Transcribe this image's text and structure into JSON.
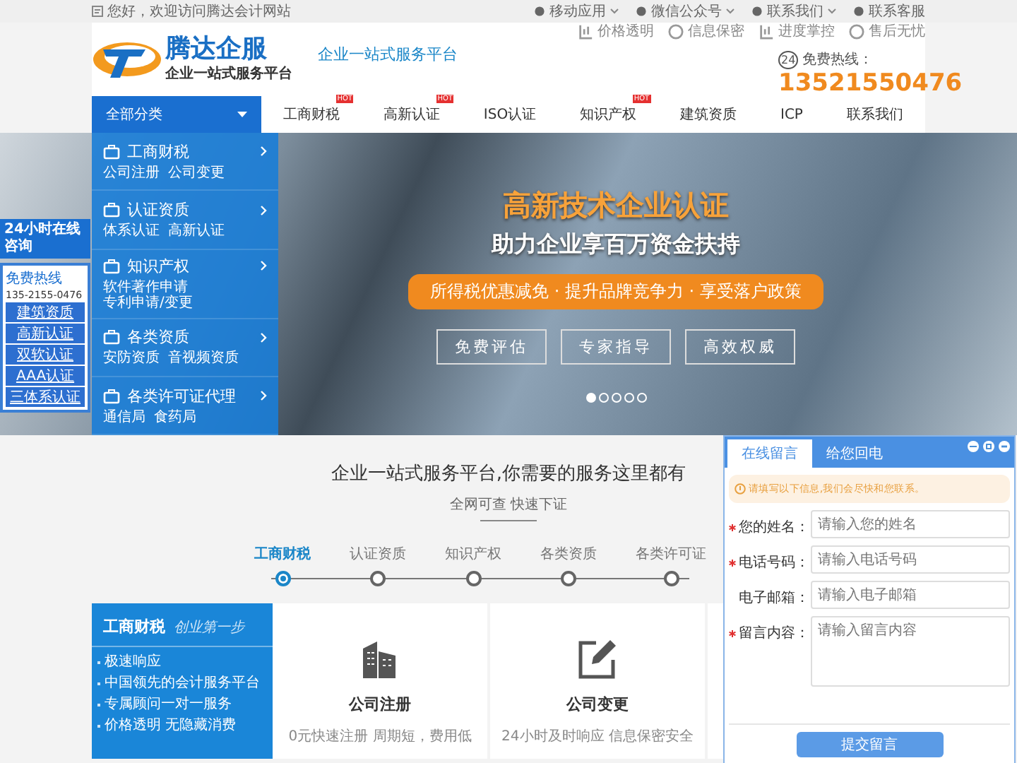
{
  "top_bar": {
    "greeting": "您好，欢迎访问腾达会计网站",
    "links": [
      {
        "label": "移动应用",
        "dropdown": true
      },
      {
        "label": "微信公众号",
        "dropdown": true
      },
      {
        "label": "联系我们",
        "dropdown": true
      },
      {
        "label": "联系客服",
        "dropdown": false
      }
    ]
  },
  "header": {
    "logo_name": "腾达企服",
    "logo_tagline": "企业一站式服务平台",
    "slogan": "企业一站式服务平台",
    "features": [
      {
        "label": "价格透明"
      },
      {
        "label": "信息保密"
      },
      {
        "label": "进度掌控"
      },
      {
        "label": "售后无忧"
      }
    ],
    "hotline": {
      "badge": "24",
      "label": "免费热线：",
      "number": "13521550476"
    }
  },
  "nav": {
    "category_label": "全部分类",
    "items": [
      {
        "label": "工商财税",
        "badge": "HOT"
      },
      {
        "label": "高新认证",
        "badge": "HOT"
      },
      {
        "label": "ISO认证"
      },
      {
        "label": "知识产权",
        "badge": "HOT"
      },
      {
        "label": "建筑资质"
      },
      {
        "label": "ICP"
      },
      {
        "label": "联系我们"
      }
    ]
  },
  "category_menu": [
    {
      "title": "工商财税",
      "links": [
        "公司注册",
        "公司变更"
      ]
    },
    {
      "title": "认证资质",
      "links": [
        "体系认证",
        "高新认证"
      ]
    },
    {
      "title": "知识产权",
      "links": [
        "软件著作申请",
        "专利申请/变更"
      ]
    },
    {
      "title": "各类资质",
      "links": [
        "安防资质",
        "音视频资质"
      ]
    },
    {
      "title": "各类许可证代理",
      "links": [
        "通信局",
        "食药局"
      ]
    }
  ],
  "hero": {
    "title": "高新技术企业认证",
    "subtitle": "助力企业享百万资金扶持",
    "banner": "所得税优惠减免 · 提升品牌竞争力 · 享受落户政策",
    "buttons": [
      "免费评估",
      "专家指导",
      "高效权威"
    ],
    "dots": [
      {
        "selected": true
      },
      {
        "selected": false
      },
      {
        "selected": false
      },
      {
        "selected": false
      },
      {
        "selected": false
      }
    ]
  },
  "consult_widget": {
    "header": "24小时在线咨询",
    "hotline_label": "免费热线",
    "phone": "135-2155-0476",
    "links": [
      "建筑资质",
      "高新认证",
      "双软认证",
      "AAA认证",
      "三体系认证"
    ]
  },
  "services": {
    "title": "企业一站式服务平台,你需要的服务这里都有",
    "subtitle": "全网可查 快速下证",
    "timeline": [
      {
        "label": "工商财税",
        "selected": true
      },
      {
        "label": "认证资质",
        "selected": false
      },
      {
        "label": "知识产权",
        "selected": false
      },
      {
        "label": "各类资质",
        "selected": false
      },
      {
        "label": "各类许可证",
        "selected": false
      }
    ],
    "panel": {
      "title": "工商财税",
      "motto": "创业第一步",
      "points": [
        "极速响应",
        "中国领先的会计服务平台",
        "专属顾问一对一服务",
        "价格透明 无隐藏消费"
      ]
    },
    "cards": [
      {
        "title": "公司注册",
        "description": "0元快速注册 周期短，费用低"
      },
      {
        "title": "公司变更",
        "description": "24小时及时响应 信息保密安全"
      }
    ]
  },
  "message_form": {
    "tabs": [
      {
        "label": "在线留言",
        "selected": true
      },
      {
        "label": "给您回电",
        "selected": false
      }
    ],
    "notice": "请填写以下信息,我们会尽快和您联系。",
    "fields": [
      {
        "label": "您的姓名：",
        "required": true,
        "placeholder": "请输入您的姓名",
        "kind": "input"
      },
      {
        "label": "电话号码：",
        "required": true,
        "placeholder": "请输入电话号码",
        "kind": "input"
      },
      {
        "label": "电子邮箱：",
        "required": false,
        "placeholder": "请输入电子邮箱",
        "kind": "input"
      },
      {
        "label": "留言内容：",
        "required": true,
        "placeholder": "请输入留言内容",
        "kind": "textarea"
      }
    ],
    "submit": "提交留言"
  }
}
